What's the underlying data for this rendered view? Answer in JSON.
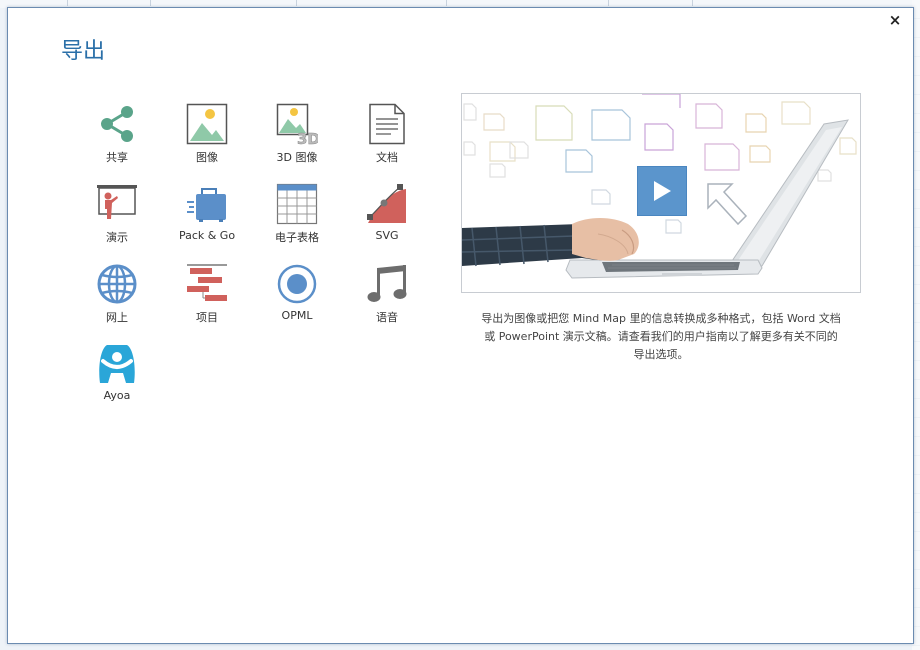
{
  "dialog": {
    "title": "导出",
    "close_label": "×"
  },
  "tiles": [
    {
      "label": "共享",
      "icon": "share-icon"
    },
    {
      "label": "图像",
      "icon": "image-icon"
    },
    {
      "label": "3D 图像",
      "icon": "3d-image-icon"
    },
    {
      "label": "文档",
      "icon": "document-icon"
    },
    {
      "label": "演示",
      "icon": "presentation-icon"
    },
    {
      "label": "Pack & Go",
      "icon": "suitcase-icon"
    },
    {
      "label": "电子表格",
      "icon": "spreadsheet-icon"
    },
    {
      "label": "SVG",
      "icon": "svg-icon"
    },
    {
      "label": "网上",
      "icon": "globe-icon"
    },
    {
      "label": "项目",
      "icon": "project-gantt-icon"
    },
    {
      "label": "OPML",
      "icon": "opml-icon"
    },
    {
      "label": "语音",
      "icon": "music-note-icon"
    },
    {
      "label": "Ayoa",
      "icon": "ayoa-logo-icon"
    }
  ],
  "video": {
    "play_icon": "play-icon"
  },
  "description": {
    "line1": "导出为图像或把您 Mind Map 里的信息转换成多种格式，包括 Word 文档",
    "line2": "或 PowerPoint 演示文稿。请查看我们的用户指南以了解更多有关不同的",
    "line3": "导出选项。"
  },
  "colors": {
    "accent": "#2a6fa8",
    "share": "#5aa48a",
    "red": "#d0615c",
    "blue": "#5b8fc9",
    "teal": "#2aa6d8",
    "gray": "#6d6d6d"
  }
}
